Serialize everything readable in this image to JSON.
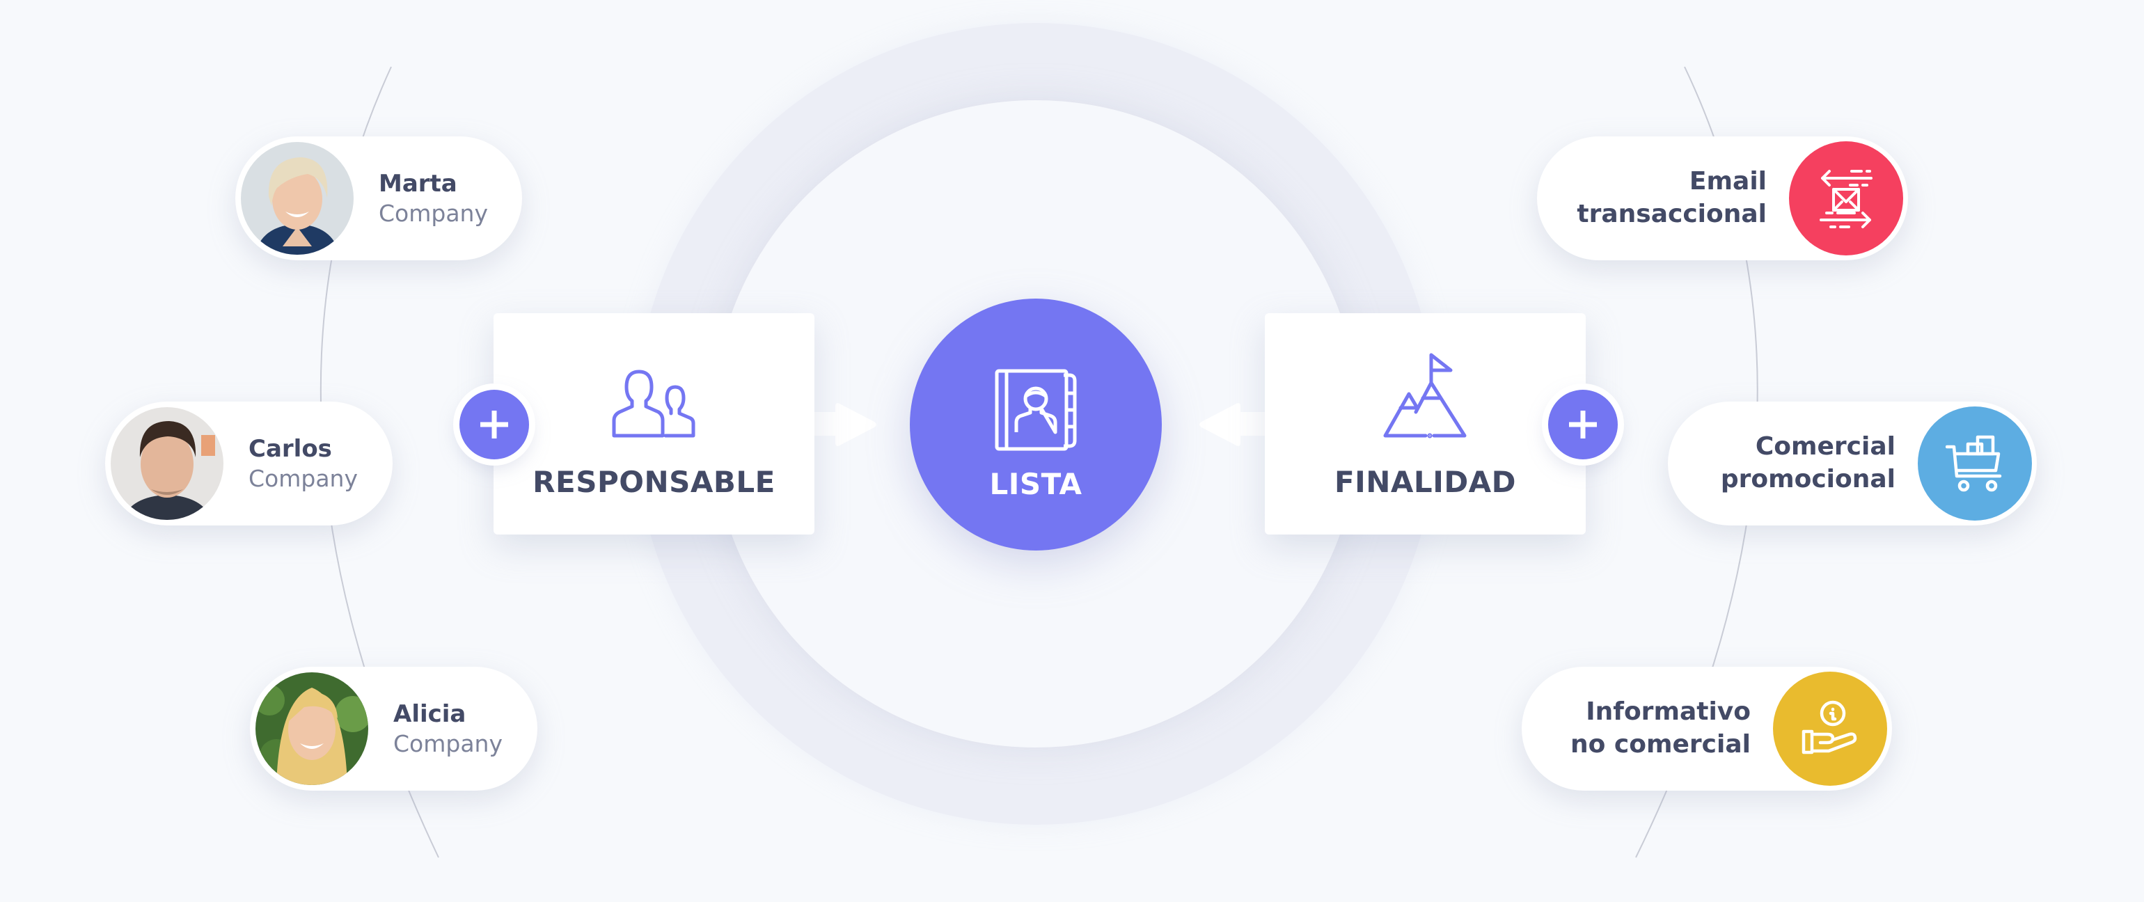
{
  "colors": {
    "background": "#f7f9fc",
    "accent_purple": "#7476f2",
    "email_red": "#f5405f",
    "promo_blue": "#5dade2",
    "info_yellow": "#e9bb2e",
    "text_dark": "#434a66",
    "text_muted": "#7c8299"
  },
  "responsables": [
    {
      "name": "Marta",
      "company": "Company",
      "avatar": "avatar-photo-marta"
    },
    {
      "name": "Carlos",
      "company": "Company",
      "avatar": "avatar-photo-carlos"
    },
    {
      "name": "Alicia",
      "company": "Company",
      "avatar": "avatar-photo-alicia"
    }
  ],
  "cards": {
    "responsable": {
      "label": "RESPONSABLE",
      "icon": "users-icon",
      "add_icon": "plus-icon"
    },
    "lista": {
      "label": "LISTA",
      "icon": "contact-book-icon"
    },
    "finalidad": {
      "label": "FINALIDAD",
      "icon": "mountain-flag-icon",
      "add_icon": "plus-icon"
    }
  },
  "finalidades": [
    {
      "line1": "Email",
      "line2": "transaccional",
      "icon": "email-exchange-icon"
    },
    {
      "line1": "Comercial",
      "line2": "promocional",
      "icon": "shopping-cart-icon"
    },
    {
      "line1": "Informativo",
      "line2": "no comercial",
      "icon": "info-hand-icon"
    }
  ]
}
